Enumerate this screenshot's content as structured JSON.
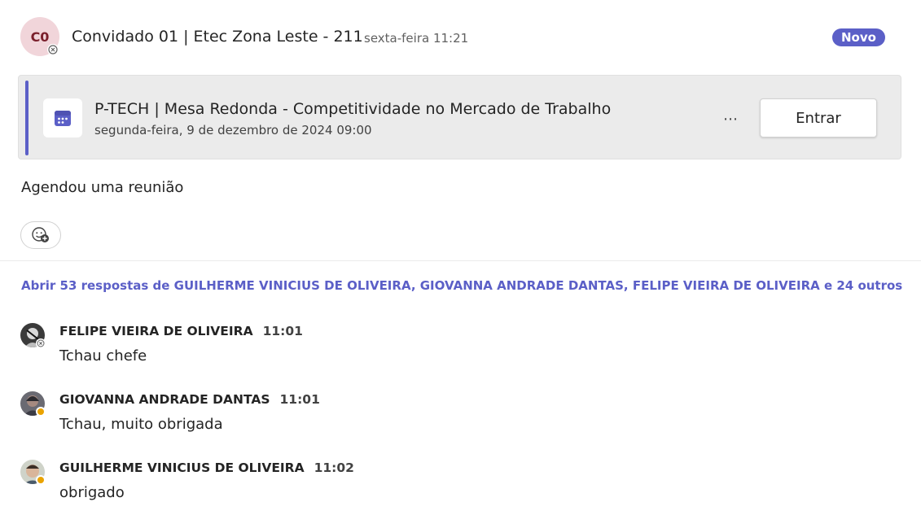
{
  "post": {
    "avatar_initials": "C0",
    "author": "Convidado 01 | Etec Zona Leste - 211",
    "time": "sexta-feira 11:21",
    "badge": "Novo"
  },
  "meeting": {
    "title": "P-TECH | Mesa Redonda - Competitividade no Mercado de Trabalho",
    "date": "segunda-feira, 9 de dezembro de 2024 09:00",
    "more_label": "⋯",
    "join_label": "Entrar"
  },
  "message": "Agendou uma reunião",
  "thread": {
    "open_replies_label": "Abrir 53 respostas de GUILHERME VINICIUS DE OLIVEIRA, GIOVANNA ANDRADE DANTAS, FELIPE VIEIRA DE OLIVEIRA e 24 outros"
  },
  "replies": [
    {
      "author": "FELIPE VIEIRA DE OLIVEIRA",
      "time": "11:01",
      "text": "Tchau chefe",
      "presence": "offline"
    },
    {
      "author": "GIOVANNA ANDRADE DANTAS",
      "time": "11:01",
      "text": "Tchau, muito obrigada",
      "presence": "away"
    },
    {
      "author": "GUILHERME VINICIUS DE OLIVEIRA",
      "time": "11:02",
      "text": "obrigado",
      "presence": "away"
    }
  ],
  "colors": {
    "accent": "#5b5fc7",
    "away": "#eaa300",
    "avatar_bg": "#f1d5da"
  }
}
